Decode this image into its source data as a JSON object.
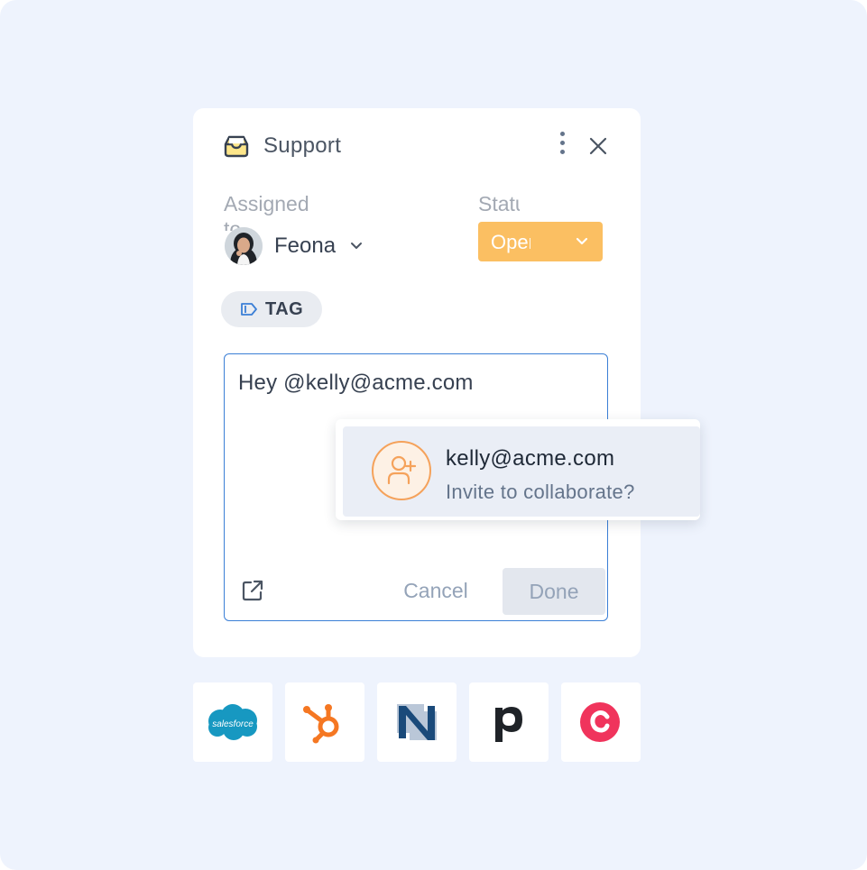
{
  "panel": {
    "title": "Support",
    "icons": {
      "title": "inbox-icon",
      "menu": "more-vertical-icon",
      "close": "close-icon"
    }
  },
  "assigned": {
    "label": "Assigned to",
    "name": "Feona",
    "icon": "chevron-down-icon"
  },
  "status": {
    "label": "Status",
    "value": "Open",
    "color": "#fbbf62"
  },
  "tag": {
    "label": "TAG",
    "icon": "tag-icon"
  },
  "editor": {
    "text": "Hey @kelly@acme.com",
    "cancel_label": "Cancel",
    "done_label": "Done",
    "icon": "external-link-icon",
    "border_color": "#3b7fd6"
  },
  "mention": {
    "email": "kelly@acme.com",
    "subtitle": "Invite to collaborate?",
    "icon": "user-plus-icon",
    "accent": "#f5a25b"
  },
  "integrations": [
    {
      "name": "salesforce",
      "label": "salesforce",
      "icon": "salesforce-logo"
    },
    {
      "name": "hubspot",
      "icon": "hubspot-logo"
    },
    {
      "name": "netsuite",
      "icon": "netsuite-logo"
    },
    {
      "name": "pipedrive",
      "icon": "pipedrive-logo"
    },
    {
      "name": "copper",
      "icon": "copper-logo"
    }
  ]
}
